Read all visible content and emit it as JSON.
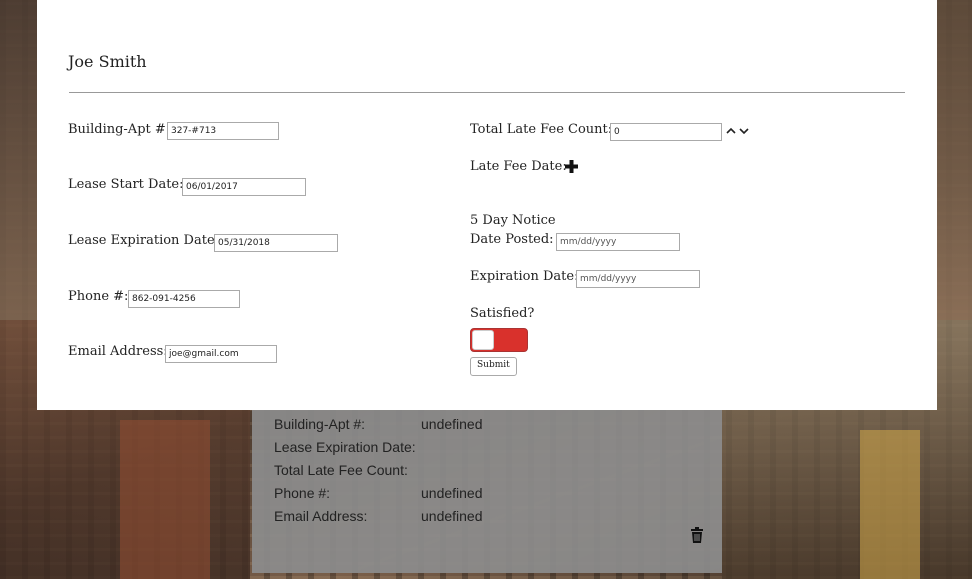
{
  "modal": {
    "title": "Joe Smith",
    "left": {
      "building_apt": {
        "label": "Building-Apt #:",
        "value": "327-#713"
      },
      "lease_start": {
        "label": "Lease Start Date:",
        "value": "06/01/2017"
      },
      "lease_expiration": {
        "label": "Lease Expiration Date:",
        "value": "05/31/2018"
      },
      "phone": {
        "label": "Phone #:",
        "value": "862-091-4256"
      },
      "email": {
        "label": "Email Address:",
        "value": "joe@gmail.com"
      }
    },
    "right": {
      "late_fee_count": {
        "label": "Total Late Fee Count:",
        "value": "0"
      },
      "late_fee_date": {
        "label": "Late Fee Date:"
      },
      "notice_heading": "5 Day Notice",
      "date_posted": {
        "label": "Date Posted:",
        "placeholder": "mm/dd/yyyy"
      },
      "expiration_date": {
        "label": "Expiration Date:",
        "placeholder": "mm/dd/yyyy"
      },
      "satisfied": {
        "label": "Satisfied?"
      },
      "submit_label": "Submit"
    },
    "toggle_color": "#d9312c"
  },
  "card": {
    "rows": [
      {
        "label": "Building-Apt #:",
        "value": "undefined"
      },
      {
        "label": "Lease Expiration Date:",
        "value": ""
      },
      {
        "label": "Total Late Fee Count:",
        "value": ""
      },
      {
        "label": "Phone #:",
        "value": "undefined"
      },
      {
        "label": "Email Address:",
        "value": "undefined"
      }
    ],
    "delete_icon": "trash-icon"
  }
}
